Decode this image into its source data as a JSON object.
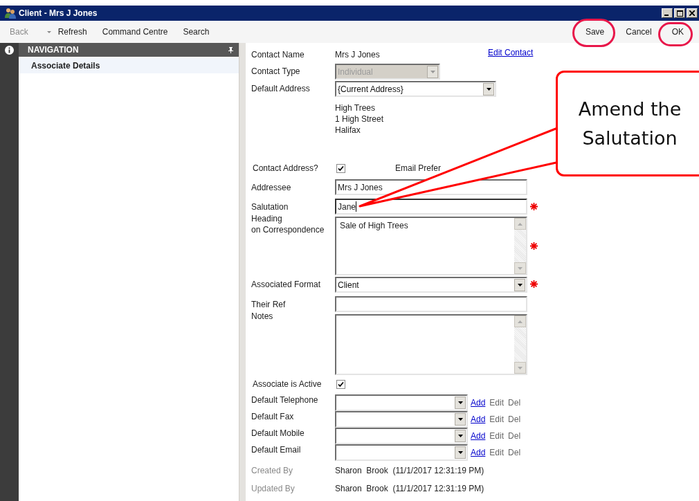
{
  "window": {
    "title": "Client - Mrs J Jones"
  },
  "toolbar": {
    "left": [
      {
        "label": "Back",
        "disabled": true,
        "dropdown": true
      },
      {
        "label": "Refresh",
        "disabled": false
      },
      {
        "label": "Command Centre",
        "disabled": false
      },
      {
        "label": "Search",
        "disabled": false
      }
    ],
    "right": [
      {
        "label": "Save",
        "circled": true
      },
      {
        "label": "Cancel"
      },
      {
        "label": "OK",
        "circled": true
      }
    ]
  },
  "navigation": {
    "title": "NAVIGATION",
    "items": [
      {
        "label": "Associate Details",
        "selected": true
      }
    ]
  },
  "form": {
    "rows": [
      {
        "kind": "text",
        "label": "Contact Name",
        "value": "Mrs J Jones",
        "link": "Edit Contact"
      },
      {
        "kind": "combo",
        "label": "Contact Type",
        "value": "Individual",
        "disabled": true
      },
      {
        "kind": "combo",
        "label": "Default Address",
        "value": "{Current Address}",
        "disabled": false
      },
      {
        "kind": "address",
        "lines": [
          "High Trees",
          "1 High Street",
          "Halifax"
        ]
      },
      {
        "kind": "checkbox",
        "label": "Contact Address?",
        "checked": true,
        "extra": "Email Prefer"
      },
      {
        "kind": "input",
        "label": "Addressee",
        "value": "Mrs J Jones",
        "focused": false
      },
      {
        "kind": "input",
        "label": "Salutation",
        "value": "Jane",
        "required": true,
        "focused": true
      },
      {
        "kind": "textarea",
        "label": "Heading\non Correspondence",
        "value": "Sale of High Trees",
        "required": true
      },
      {
        "kind": "combo",
        "label": "Associated Format",
        "value": "Client",
        "disabled": false,
        "required": true
      },
      {
        "kind": "input",
        "label": "Their Ref",
        "focused": false
      },
      {
        "kind": "textarea",
        "label": "Notes"
      },
      {
        "kind": "checkbox",
        "label": "Associate is Active",
        "checked": true
      },
      {
        "kind": "contact",
        "label": "Default Telephone",
        "actions": [
          {
            "label": "Add",
            "link": true
          },
          {
            "label": "Edit",
            "link": false
          },
          {
            "label": "Del",
            "link": false
          }
        ]
      },
      {
        "kind": "contact",
        "label": "Default Fax",
        "actions": [
          {
            "label": "Add",
            "link": true
          },
          {
            "label": "Edit",
            "link": false
          },
          {
            "label": "Del",
            "link": false
          }
        ]
      },
      {
        "kind": "contact",
        "label": "Default Mobile",
        "actions": [
          {
            "label": "Add",
            "link": true
          },
          {
            "label": "Edit",
            "link": false
          },
          {
            "label": "Del",
            "link": false
          }
        ]
      },
      {
        "kind": "contact",
        "label": "Default Email",
        "actions": [
          {
            "label": "Add",
            "link": true
          },
          {
            "label": "Edit",
            "link": false
          },
          {
            "label": "Del",
            "link": false
          }
        ]
      },
      {
        "kind": "meta",
        "label": "Created By",
        "value": "Sharon  Brook  (11/1/2017 12:31:19 PM)"
      },
      {
        "kind": "meta",
        "label": "Updated By",
        "value": "Sharon  Brook  (11/1/2017 12:31:19 PM)"
      }
    ]
  },
  "callout": {
    "text": "Amend the Salutation"
  }
}
